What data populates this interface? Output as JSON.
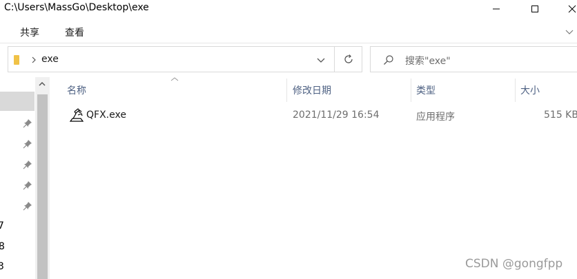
{
  "window": {
    "title": "C:\\Users\\MassGo\\Desktop\\exe"
  },
  "ribbon": {
    "tabs": [
      {
        "label": "共享"
      },
      {
        "label": "查看"
      }
    ]
  },
  "address_bar": {
    "path_segment": "exe",
    "folder_color": "#f0c247"
  },
  "search": {
    "placeholder": "搜索\"exe\""
  },
  "nav_pane": {
    "fragments": [
      "7",
      "8",
      "3"
    ]
  },
  "columns": [
    {
      "label": "名称"
    },
    {
      "label": "修改日期"
    },
    {
      "label": "类型"
    },
    {
      "label": "大小"
    }
  ],
  "files": [
    {
      "name": "QFX.exe",
      "modified": "2021/11/29 16:54",
      "type": "应用程序",
      "size": "515 KB"
    }
  ],
  "watermark": {
    "text": "CSDN @gongfpp"
  },
  "colors": {
    "header_text": "#4d6082",
    "selection": "#d9d9d9"
  }
}
